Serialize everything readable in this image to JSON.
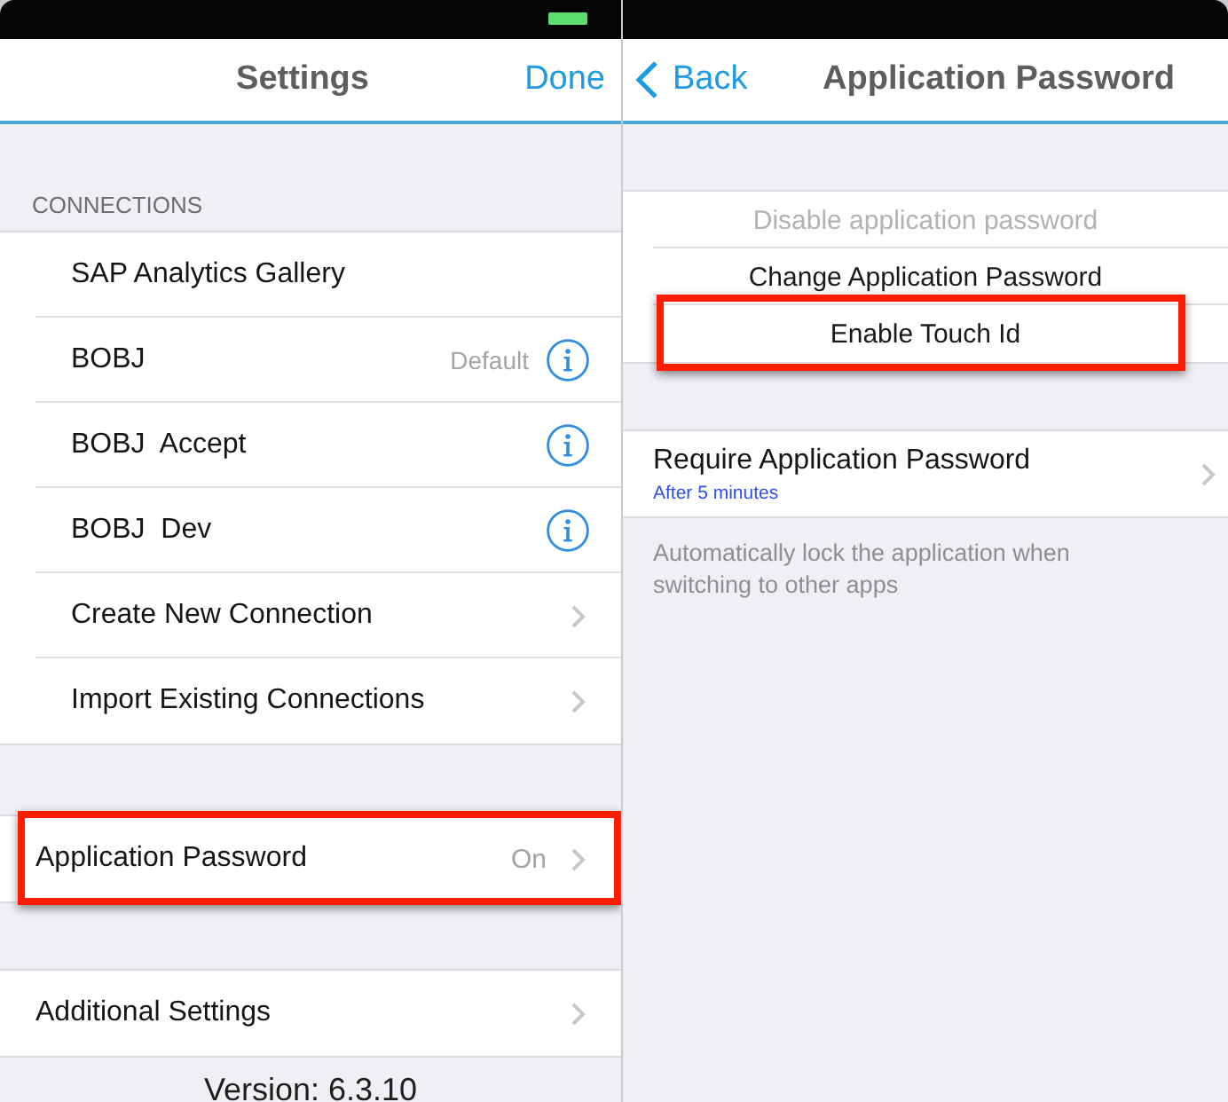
{
  "settings_screen": {
    "nav_bar": {
      "title": "Settings",
      "done_button": "Done"
    },
    "sections": [
      {
        "header": "CONNECTIONS",
        "rows": [
          {
            "label": "SAP Analytics Gallery",
            "kind": "plain",
            "highlighted": false
          },
          {
            "label": "BOBJ",
            "detail": "Default",
            "kind": "info",
            "highlighted": false
          },
          {
            "label": "BOBJ  Accept",
            "kind": "info",
            "highlighted": false
          },
          {
            "label": "BOBJ  Dev",
            "kind": "info",
            "highlighted": false
          },
          {
            "label": "Create New Connection",
            "kind": "disclosure",
            "highlighted": false
          },
          {
            "label": "Import Existing Connections",
            "kind": "disclosure",
            "highlighted": false
          }
        ]
      },
      {
        "rows": [
          {
            "label": "Application Password",
            "detail": "On",
            "kind": "disclosure",
            "highlighted": true
          }
        ]
      },
      {
        "rows": [
          {
            "label": "Additional Settings",
            "kind": "disclosure",
            "highlighted": false
          }
        ]
      }
    ],
    "version": "Version: 6.3.10"
  },
  "password_screen": {
    "nav_bar": {
      "back_button": "Back",
      "title": "Application Password"
    },
    "sections": [
      {
        "rows": [
          {
            "label": "Disable application password",
            "kind": "action",
            "disabled": true,
            "highlighted": false
          },
          {
            "label": "Change Application Password",
            "kind": "action",
            "disabled": false,
            "highlighted": false
          },
          {
            "label": "Enable Touch Id",
            "kind": "action",
            "disabled": false,
            "highlighted": true
          }
        ]
      },
      {
        "rows": [
          {
            "label": "Require Application Password",
            "subtitle": "After 5 minutes",
            "kind": "disclosure",
            "disabled": false,
            "highlighted": false
          }
        ],
        "footer": "Automatically lock the application when switching to other apps"
      }
    ]
  }
}
